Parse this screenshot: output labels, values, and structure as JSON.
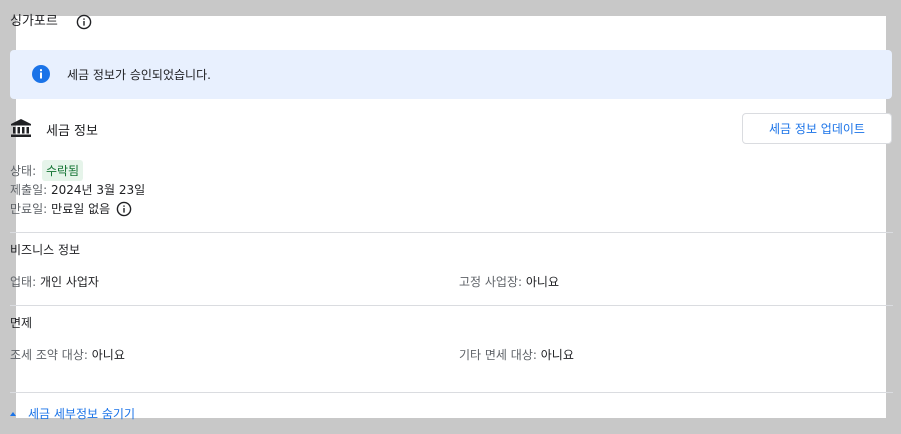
{
  "header": {
    "country": "싱가포르",
    "info_icon": "info-outline-icon"
  },
  "banner": {
    "icon": "info-filled-icon",
    "message": "세금 정보가 승인되었습니다."
  },
  "tax_info": {
    "icon": "bank-icon",
    "title": "세금 정보",
    "update_button": "세금 정보 업데이트",
    "status_label": "상태:",
    "status_value": "수락됨",
    "submitted_label": "제출일:",
    "submitted_value": "2024년 3월 23일",
    "expiry_label": "만료일:",
    "expiry_value": "만료일 없음"
  },
  "business_info": {
    "title": "비즈니스 정보",
    "business_type_label": "업태:",
    "business_type_value": "개인 사업자",
    "fixed_place_label": "고정 사업장:",
    "fixed_place_value": "아니요"
  },
  "exemption": {
    "title": "면제",
    "treaty_label": "조세 조약 대상:",
    "treaty_value": "아니요",
    "other_label": "기타 면세 대상:",
    "other_value": "아니요"
  },
  "footer": {
    "collapse_link": "세금 세부정보 숨기기"
  },
  "colors": {
    "accent_blue": "#1a73e8",
    "banner_bg": "#e8f0fe",
    "status_green_bg": "#e6f4ea",
    "status_green_text": "#137333",
    "outer_frame": "#c8c8c8"
  }
}
